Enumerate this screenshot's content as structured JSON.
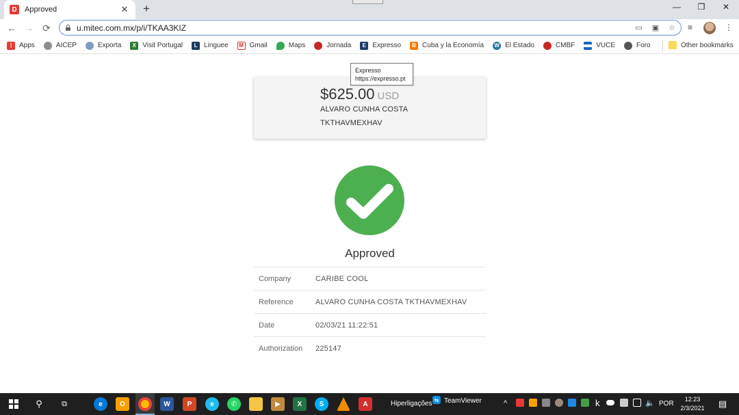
{
  "browser": {
    "tab_title": "Approved",
    "tab_close": "✕",
    "new_tab": "+",
    "url": "u.mitec.com.mx/p/i/TKAA3KIZ",
    "window_controls": {
      "minimize": "—",
      "restore": "❐",
      "close": "✕"
    }
  },
  "bookmarks": {
    "items": [
      {
        "label": "Apps",
        "icon": "apps-grid-icon",
        "color": "#e53935"
      },
      {
        "label": "AICEP",
        "icon": "aicep-icon",
        "color": "#8d8d8d"
      },
      {
        "label": "Exporta",
        "icon": "globe-icon",
        "color": "#7e9cc4"
      },
      {
        "label": "Visit Portugal",
        "icon": "visit-portugal-icon",
        "color": "#2e7d32"
      },
      {
        "label": "Linguee",
        "icon": "linguee-icon",
        "color": "#1a3a5c"
      },
      {
        "label": "Gmail",
        "icon": "gmail-icon",
        "color": "#d93025"
      },
      {
        "label": "Maps",
        "icon": "maps-pin-icon",
        "color": "#34a853"
      },
      {
        "label": "Jornada",
        "icon": "jornada-icon",
        "color": "#c62828"
      },
      {
        "label": "Expresso",
        "icon": "expresso-icon",
        "color": "#1b3a6b"
      },
      {
        "label": "Cuba y la Economía",
        "icon": "blogger-icon",
        "color": "#f57c00"
      },
      {
        "label": "El Estado",
        "icon": "wordpress-icon",
        "color": "#21759b"
      },
      {
        "label": "CMBF",
        "icon": "rss-icon",
        "color": "#c62828"
      },
      {
        "label": "VUCE",
        "icon": "cuba-flag-icon",
        "color": "#1565c0"
      },
      {
        "label": "Foro",
        "icon": "globe-dark-icon",
        "color": "#555555"
      }
    ],
    "other": "Other bookmarks"
  },
  "tooltip": {
    "title": "Expresso",
    "url": "https://expresso.pt"
  },
  "payment": {
    "amount": "$625.00",
    "currency": "USD",
    "payer": "ALVARO CUNHA COSTA",
    "code": "TKTHAVMEXHAV"
  },
  "status": {
    "title": "Approved",
    "color": "#4caf50"
  },
  "details": [
    {
      "label": "Company",
      "value": "CARIBE COOL"
    },
    {
      "label": "Reference",
      "value": "ALVARO CUNHA COSTA TKTHAVMEXHAV"
    },
    {
      "label": "Date",
      "value": "02/03/21 11:22:51"
    },
    {
      "label": "Authorization",
      "value": "225147"
    }
  ],
  "taskbar": {
    "hiperligacoes": "Hiperligações",
    "teamviewer": "TeamViewer",
    "language": "POR",
    "time": "12:23",
    "date": "2/3/2021"
  }
}
